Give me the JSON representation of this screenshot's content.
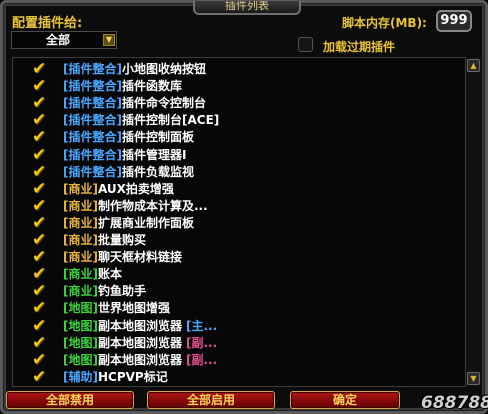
{
  "window": {
    "title": "插件列表",
    "config_label": "配置插件给:",
    "config_dropdown_value": "全部",
    "memory_label": "脚本内存(MB):",
    "memory_value": "999",
    "load_expired_label": "加载过期插件",
    "load_expired_checked": false
  },
  "plugins": [
    {
      "tag": "[插件整合]",
      "name": "小地图收纳按钮",
      "extra": "",
      "checked": true,
      "tag_color": "#4aa6ff"
    },
    {
      "tag": "[插件整合]",
      "name": "插件函数库",
      "extra": "",
      "checked": true,
      "tag_color": "#4aa6ff"
    },
    {
      "tag": "[插件整合]",
      "name": "插件命令控制台",
      "extra": "",
      "checked": true,
      "tag_color": "#4aa6ff"
    },
    {
      "tag": "[插件整合]",
      "name": "插件控制台[ACE]",
      "extra": "",
      "checked": true,
      "tag_color": "#4aa6ff"
    },
    {
      "tag": "[插件整合]",
      "name": "插件控制面板",
      "extra": "",
      "checked": true,
      "tag_color": "#4aa6ff"
    },
    {
      "tag": "[插件整合]",
      "name": "插件管理器I",
      "extra": "",
      "checked": true,
      "tag_color": "#4aa6ff"
    },
    {
      "tag": "[插件整合]",
      "name": "插件负载监视",
      "extra": "",
      "checked": true,
      "tag_color": "#4aa6ff"
    },
    {
      "tag": "[商业]",
      "name": "AUX拍卖增强",
      "extra": "",
      "checked": true,
      "tag_color": "#e6b43a"
    },
    {
      "tag": "[商业]",
      "name": "制作物成本计算及...",
      "extra": "",
      "checked": true,
      "tag_color": "#e6b43a"
    },
    {
      "tag": "[商业]",
      "name": "扩展商业制作面板",
      "extra": "",
      "checked": true,
      "tag_color": "#e6b43a"
    },
    {
      "tag": "[商业]",
      "name": "批量购买",
      "extra": "",
      "checked": true,
      "tag_color": "#e6b43a"
    },
    {
      "tag": "[商业]",
      "name": "聊天框材料链接",
      "extra": "",
      "checked": true,
      "tag_color": "#e6b43a"
    },
    {
      "tag": "[商业]",
      "name": "账本",
      "extra": "",
      "checked": true,
      "tag_color": "#3ed13e"
    },
    {
      "tag": "[商业]",
      "name": "钓鱼助手",
      "extra": "",
      "checked": true,
      "tag_color": "#3ed13e"
    },
    {
      "tag": "[地图]",
      "name": "世界地图增强",
      "extra": "",
      "checked": true,
      "tag_color": "#3ed13e"
    },
    {
      "tag": "[地图]",
      "name": "副本地图浏览器",
      "extra": "[主...",
      "checked": true,
      "tag_color": "#3ed13e",
      "extra_color": "#4aa6ff"
    },
    {
      "tag": "[地图]",
      "name": "副本地图浏览器",
      "extra": "[副...",
      "checked": true,
      "tag_color": "#3ed13e",
      "extra_color": "#e0508a"
    },
    {
      "tag": "[地图]",
      "name": "副本地图浏览器",
      "extra": "[副...",
      "checked": true,
      "tag_color": "#3ed13e",
      "extra_color": "#e0508a"
    },
    {
      "tag": "[辅助]",
      "name": "HCPVP标记",
      "extra": "",
      "checked": true,
      "tag_color": "#4aa6ff"
    }
  ],
  "buttons": {
    "disable_all": "全部禁用",
    "enable_all": "全部启用",
    "ok": "确定"
  },
  "watermark": "688788"
}
